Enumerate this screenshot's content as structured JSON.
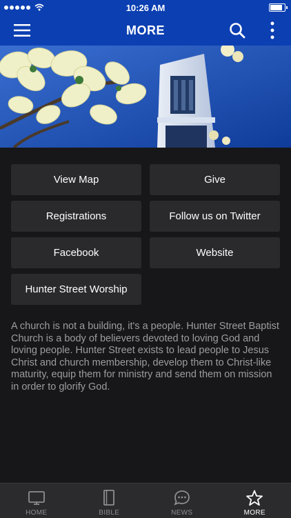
{
  "status_bar": {
    "time": "10:26 AM",
    "signal_icon": "cellular-signal-icon",
    "wifi_icon": "wifi-icon",
    "battery_icon": "battery-icon",
    "battery_level": 0.95
  },
  "header": {
    "title": "MORE",
    "menu_icon": "hamburger-menu-icon",
    "search_icon": "search-icon",
    "more_icon": "vertical-ellipsis-icon",
    "background_color": "#0b3fb2"
  },
  "hero": {
    "description_icon": "church-steeple-dogwood-photo"
  },
  "buttons": [
    {
      "label": "View Map"
    },
    {
      "label": "Give"
    },
    {
      "label": "Registrations"
    },
    {
      "label": "Follow us on Twitter"
    },
    {
      "label": "Facebook"
    },
    {
      "label": "Website"
    },
    {
      "label": "Hunter Street Worship"
    }
  ],
  "about_text": "A church is not a building, it's a people.  Hunter Street Baptist Church is a body of believers devoted to loving God and loving people.  Hunter Street exists to lead people to Jesus Christ and church membership, develop them to Christ-like maturity, equip them for ministry and send them on mission in order to glorify God.",
  "tabs": [
    {
      "label": "HOME",
      "icon": "tv-icon",
      "active": false
    },
    {
      "label": "BIBLE",
      "icon": "book-icon",
      "active": false
    },
    {
      "label": "NEWS",
      "icon": "chat-bubble-icon",
      "active": false
    },
    {
      "label": "MORE",
      "icon": "star-icon",
      "active": true
    }
  ],
  "colors": {
    "accent": "#0b3fb2",
    "background": "#171719",
    "button": "#2a2a2c",
    "tabbar": "#2b2b2d"
  }
}
